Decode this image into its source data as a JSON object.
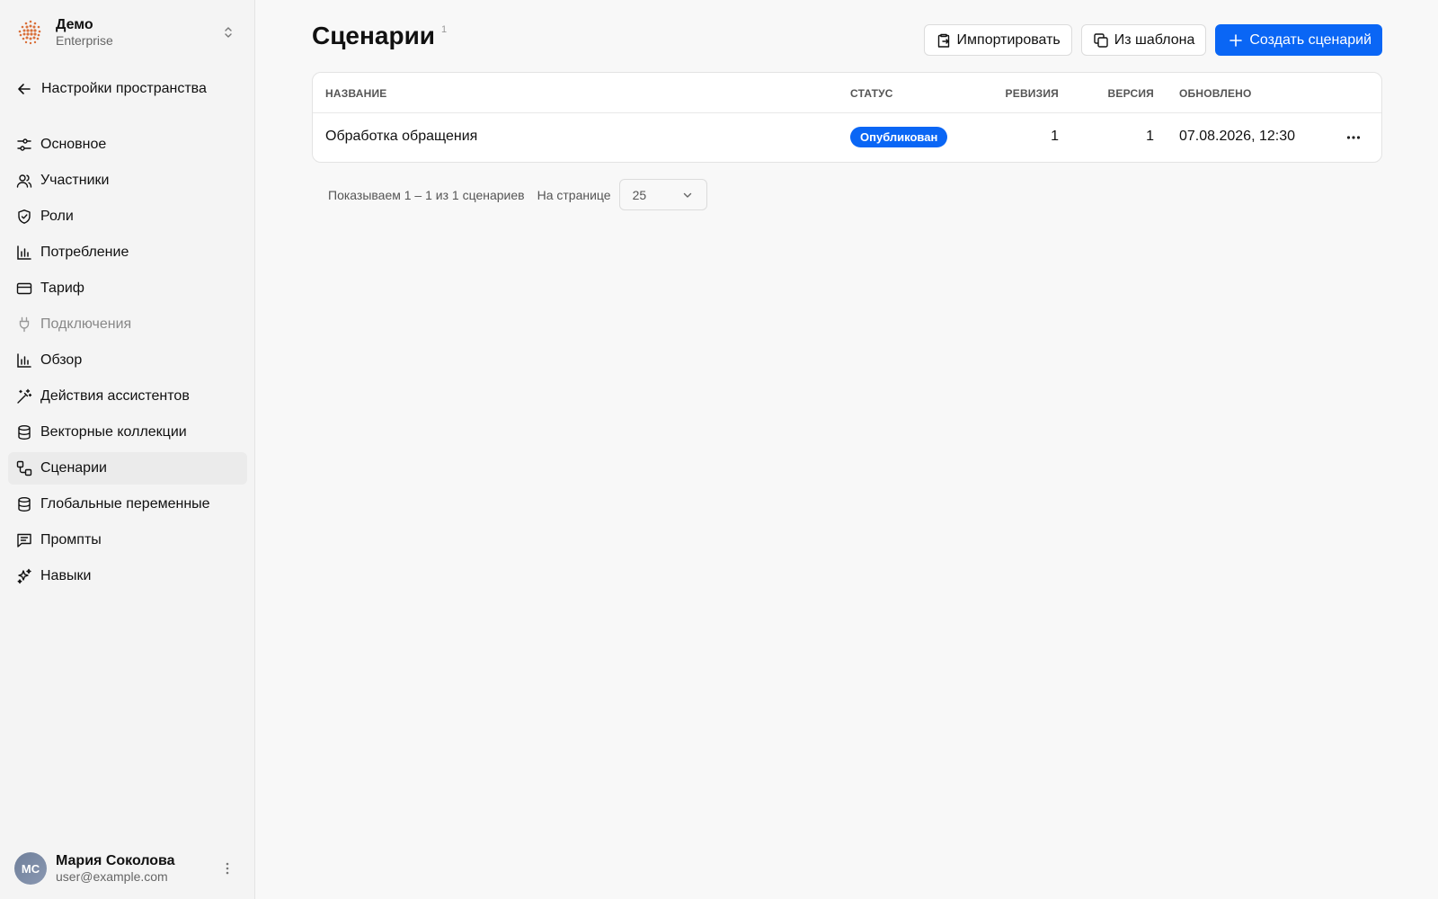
{
  "workspace": {
    "name": "Демо",
    "plan": "Enterprise"
  },
  "sidebar": {
    "back_label": "Настройки пространства",
    "items": [
      {
        "label": "Основное",
        "icon": "sliders-icon"
      },
      {
        "label": "Участники",
        "icon": "users-icon"
      },
      {
        "label": "Роли",
        "icon": "shield-icon"
      },
      {
        "label": "Потребление",
        "icon": "bar-chart-icon"
      },
      {
        "label": "Тариф",
        "icon": "credit-card-icon"
      },
      {
        "label": "Подключения",
        "icon": "plug-icon",
        "muted": true
      },
      {
        "label": "Обзор",
        "icon": "bar-chart-icon"
      },
      {
        "label": "Действия ассистентов",
        "icon": "magic-wand-icon"
      },
      {
        "label": "Векторные коллекции",
        "icon": "database-icon"
      },
      {
        "label": "Сценарии",
        "icon": "workflow-icon",
        "active": true
      },
      {
        "label": "Глобальные переменные",
        "icon": "database-icon"
      },
      {
        "label": "Промпты",
        "icon": "message-icon"
      },
      {
        "label": "Навыки",
        "icon": "sparkles-icon"
      }
    ]
  },
  "user": {
    "initials": "МС",
    "name": "Мария Соколова",
    "email": "user@example.com"
  },
  "page": {
    "title": "Сценарии",
    "count": "1",
    "actions": {
      "import": "Импортировать",
      "template": "Из шаблона",
      "create": "Создать сценарий"
    }
  },
  "table": {
    "columns": {
      "name": "НАЗВАНИЕ",
      "status": "СТАТУС",
      "revision": "РЕВИЗИЯ",
      "version": "ВЕРСИЯ",
      "updated": "ОБНОВЛЕНО"
    },
    "rows": [
      {
        "name": "Обработка обращения",
        "status": "Опубликован",
        "revision": "1",
        "version": "1",
        "updated": "07.08.2026, 12:30"
      }
    ]
  },
  "pagination": {
    "summary": "Показываем 1 – 1 из 1 сценариев",
    "per_page_label": "На странице",
    "per_page_value": "25"
  },
  "colors": {
    "accent": "#0a66f5",
    "sidebar_bg": "#f4f4f4",
    "page_bg": "#f8f8f8"
  }
}
